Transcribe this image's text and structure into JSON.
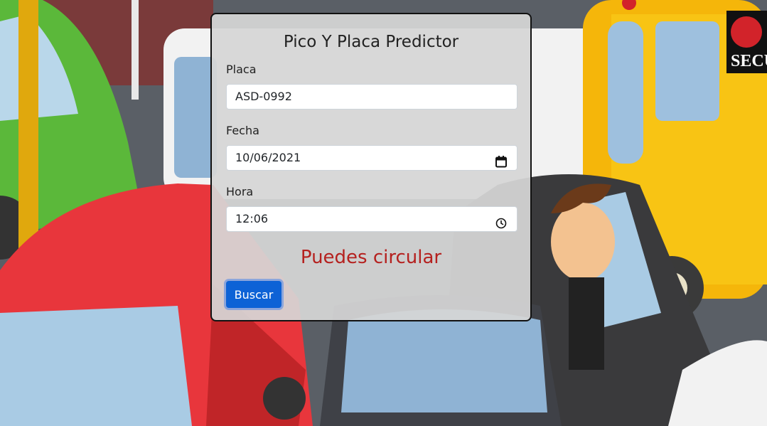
{
  "form": {
    "title": "Pico Y Placa Predictor",
    "placa_label": "Placa",
    "placa_value": "ASD-0992",
    "fecha_label": "Fecha",
    "fecha_value": "10/06/2021",
    "hora_label": "Hora",
    "hora_value": "12:06",
    "result_text": "Puedes circular",
    "button_label": "Buscar"
  },
  "background": {
    "sign_text": "SECU"
  },
  "colors": {
    "result": "#b5211f",
    "button": "#0d62d6"
  },
  "icons": {
    "fecha": "calendar-icon",
    "hora": "clock-icon"
  }
}
